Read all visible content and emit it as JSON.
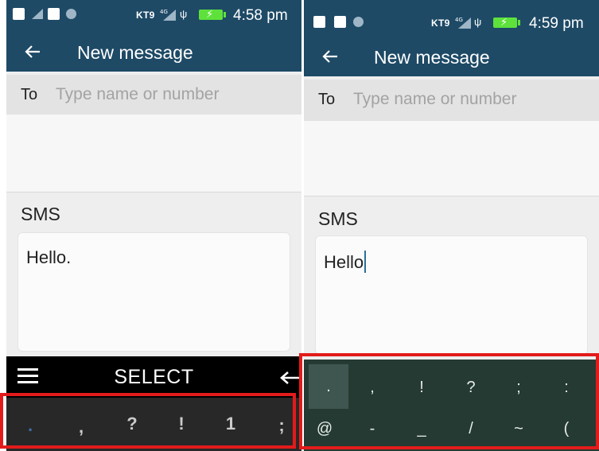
{
  "left": {
    "status": {
      "carrier": "KT9",
      "network": "4G",
      "time": "4:58 pm"
    },
    "title": "New message",
    "to": {
      "label": "To",
      "placeholder": "Type name or number"
    },
    "sms": {
      "label": "SMS",
      "text": "Hello."
    },
    "selectbar": {
      "label": "SELECT"
    },
    "keys": [
      ".",
      ",",
      "?",
      "!",
      "1",
      ";"
    ]
  },
  "right": {
    "status": {
      "carrier": "KT9",
      "network": "4G",
      "time": "4:59 pm"
    },
    "title": "New message",
    "to": {
      "label": "To",
      "placeholder": "Type name or number"
    },
    "sms": {
      "label": "SMS",
      "text": "Hello"
    },
    "keys_row1": [
      ".",
      ",",
      "!",
      "?",
      ";",
      ":"
    ],
    "keys_row2": [
      "@",
      "-",
      "_",
      "/",
      "~",
      "("
    ]
  },
  "colors": {
    "appbar": "#1e4a66",
    "highlight": "#e31b1b",
    "battery": "#5ee23b",
    "keyboard_right": "#253a32"
  }
}
